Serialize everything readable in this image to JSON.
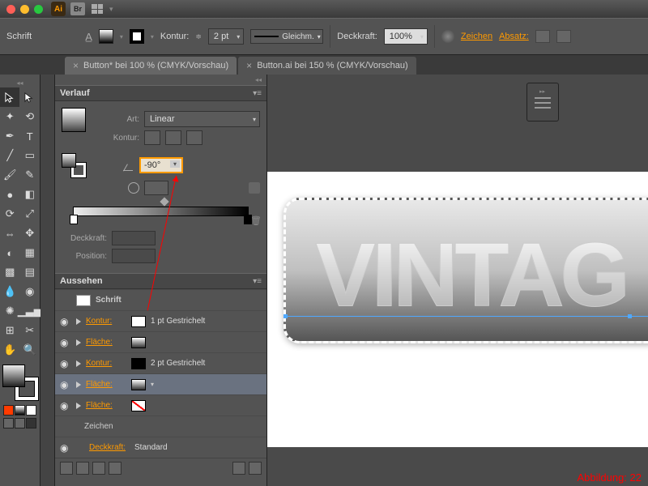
{
  "titlebar": {
    "app": "Ai",
    "br": "Br"
  },
  "controlbar": {
    "schrift": "Schrift",
    "kontur": "Kontur:",
    "stroke_weight": "2 pt",
    "line_style": "Gleichm.",
    "deckkraft_label": "Deckkraft:",
    "deckkraft_value": "100%",
    "zeichen": "Zeichen",
    "absatz": "Absatz:"
  },
  "tabs": [
    {
      "label": "Button* bei 100 % (CMYK/Vorschau)"
    },
    {
      "label": "Button.ai bei 150 % (CMYK/Vorschau)"
    }
  ],
  "verlauf": {
    "title": "Verlauf",
    "art_label": "Art:",
    "art_value": "Linear",
    "kontur_label": "Kontur:",
    "angle_value": "-90°",
    "deckkraft_label": "Deckkraft:",
    "position_label": "Position:"
  },
  "aussehen": {
    "title": "Aussehen",
    "schrift": "Schrift",
    "rows": [
      {
        "label": "Kontur:",
        "value": "1 pt Gestrichelt",
        "swatch": "#fff"
      },
      {
        "label": "Fläche:",
        "value": "",
        "swatch": "grad"
      },
      {
        "label": "Kontur:",
        "value": "2 pt Gestrichelt",
        "swatch": "#000"
      },
      {
        "label": "Fläche:",
        "value": "",
        "swatch": "grad",
        "selected": true
      },
      {
        "label": "Fläche:",
        "value": "",
        "swatch": "none"
      }
    ],
    "zeichen": "Zeichen",
    "deckkraft_label": "Deckkraft:",
    "deckkraft_value": "Standard"
  },
  "canvas": {
    "text": "VINTAG",
    "caption": "Abbildung: 22"
  }
}
